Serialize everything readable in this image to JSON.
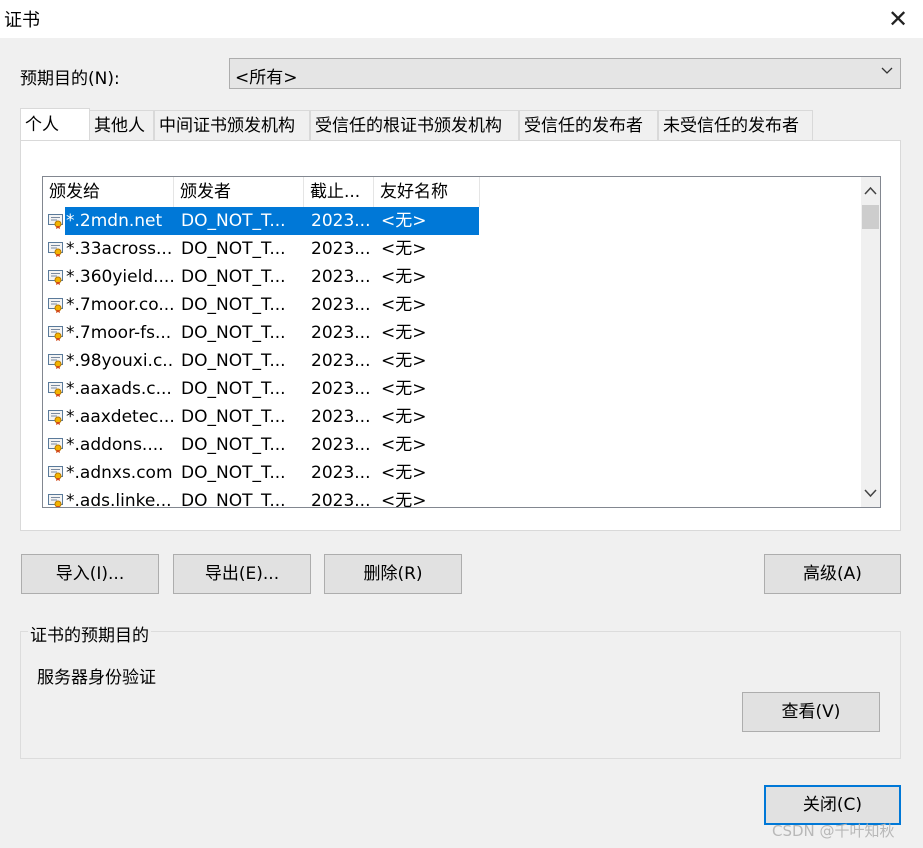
{
  "window": {
    "title": "证书",
    "close_glyph": "✕"
  },
  "purpose": {
    "label": "预期目的(N):",
    "value": "<所有>"
  },
  "tabs": [
    {
      "label": "个人",
      "active": true
    },
    {
      "label": "其他人",
      "active": false
    },
    {
      "label": "中间证书颁发机构",
      "active": false
    },
    {
      "label": "受信任的根证书颁发机构",
      "active": false
    },
    {
      "label": "受信任的发布者",
      "active": false
    },
    {
      "label": "未受信任的发布者",
      "active": false
    }
  ],
  "list": {
    "columns": [
      "颁发给",
      "颁发者",
      "截止...",
      "友好名称"
    ],
    "rows": [
      {
        "issued_to": "*.2mdn.net",
        "issuer": "DO_NOT_T...",
        "expiry": "2023...",
        "friendly": "<无>",
        "selected": true
      },
      {
        "issued_to": "*.33across....",
        "issuer": "DO_NOT_T...",
        "expiry": "2023...",
        "friendly": "<无>"
      },
      {
        "issued_to": "*.360yield....",
        "issuer": "DO_NOT_T...",
        "expiry": "2023...",
        "friendly": "<无>"
      },
      {
        "issued_to": "*.7moor.co...",
        "issuer": "DO_NOT_T...",
        "expiry": "2023...",
        "friendly": "<无>"
      },
      {
        "issued_to": "*.7moor-fs...",
        "issuer": "DO_NOT_T...",
        "expiry": "2023...",
        "friendly": "<无>"
      },
      {
        "issued_to": "*.98youxi.c...",
        "issuer": "DO_NOT_T...",
        "expiry": "2023...",
        "friendly": "<无>"
      },
      {
        "issued_to": "*.aaxads.c...",
        "issuer": "DO_NOT_T...",
        "expiry": "2023...",
        "friendly": "<无>"
      },
      {
        "issued_to": "*.aaxdetec...",
        "issuer": "DO_NOT_T...",
        "expiry": "2023...",
        "friendly": "<无>"
      },
      {
        "issued_to": "*.addons....",
        "issuer": "DO_NOT_T...",
        "expiry": "2023...",
        "friendly": "<无>"
      },
      {
        "issued_to": "*.adnxs.com",
        "issuer": "DO_NOT_T...",
        "expiry": "2023...",
        "friendly": "<无>"
      },
      {
        "issued_to": "*.ads.linke...",
        "issuer": "DO_NOT_T...",
        "expiry": "2023...",
        "friendly": "<无>"
      }
    ]
  },
  "buttons": {
    "import": "导入(I)...",
    "export": "导出(E)...",
    "remove": "删除(R)",
    "advanced": "高级(A)",
    "view": "查看(V)",
    "close": "关闭(C)"
  },
  "purposes_group": {
    "title": "证书的预期目的",
    "text": "服务器身份验证"
  },
  "watermark": "CSDN @千叶知秋",
  "colors": {
    "selection": "#0078d7",
    "default_button_border": "#0078d7"
  }
}
